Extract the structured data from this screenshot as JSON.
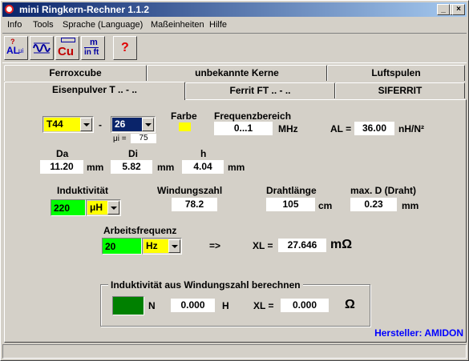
{
  "window": {
    "title": "mini Ringkern-Rechner 1.1.2"
  },
  "title_buttons": {
    "minimize": "_",
    "maximize": "□",
    "close": "×"
  },
  "menu": [
    "Info",
    "Tools",
    "Sprache (Language)",
    "Maßeinheiten",
    "Hilfe"
  ],
  "toolbar": {
    "al_label": "AL",
    "al_sub": "μi",
    "cu_label": "Cu",
    "m_label": "m",
    "inft_label": "in ft",
    "help_label": "?"
  },
  "tabs_row1": [
    "Ferroxcube",
    "unbekannte Kerne",
    "Luftspulen"
  ],
  "tabs_row2": [
    "Eisenpulver T .. - ..",
    "Ferrit FT .. - ..",
    "SIFERRIT"
  ],
  "core": {
    "type_value": "T44",
    "dash": "-",
    "mix_value": "26",
    "mui_label": "μi =",
    "mui_value": "75",
    "farbe_label": "Farbe",
    "color": "#ffff00"
  },
  "frequency": {
    "label": "Frequenzbereich",
    "value": "0...1",
    "unit": "MHz"
  },
  "al": {
    "label": "AL =",
    "value": "36.00",
    "unit": "nH/N²"
  },
  "dims": {
    "da_label": "Da",
    "da_value": "11.20",
    "da_unit": "mm",
    "di_label": "Di",
    "di_value": "5.82",
    "di_unit": "mm",
    "h_label": "h",
    "h_value": "4.04",
    "h_unit": "mm"
  },
  "inductance": {
    "label": "Induktivität",
    "value": "220",
    "unit": "μH"
  },
  "turns": {
    "label": "Windungszahl",
    "value": "78.2"
  },
  "wire_length": {
    "label": "Drahtlänge",
    "value": "105",
    "unit": "cm"
  },
  "max_d": {
    "label": "max. D (Draht)",
    "value": "0.23",
    "unit": "mm"
  },
  "work_freq": {
    "label": "Arbeitsfrequenz",
    "value": "20",
    "unit": "Hz"
  },
  "xl_top": {
    "arrow": "=>",
    "label": "XL =",
    "value": "27.646",
    "unit": "mΩ"
  },
  "group": {
    "title": "Induktivität aus Windungszahl berechnen",
    "n_label": "N",
    "h_value": "0.000",
    "h_unit": "H",
    "xl_label": "XL =",
    "xl_value": "0.000",
    "xl_unit": "Ω"
  },
  "manufacturer": "Hersteller: AMIDON",
  "colors": {
    "green": "#00ff00",
    "yellow": "#ffff00",
    "dark_green": "#008000",
    "navy": "#0a246a",
    "blue_text": "#0000ff"
  }
}
